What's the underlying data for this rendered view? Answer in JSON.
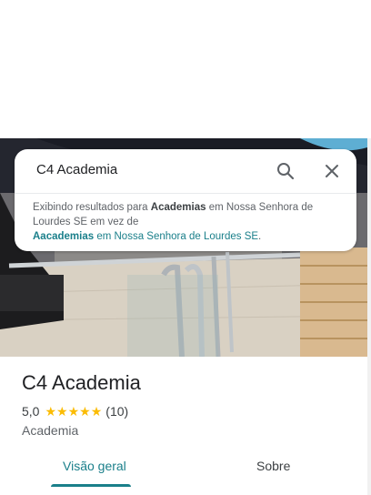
{
  "search": {
    "query": "C4 Academia",
    "search_icon": "search-icon",
    "close_icon": "close-icon"
  },
  "suggestion": {
    "prefix": "Exibindo resultados para ",
    "corrected_term": "Academias",
    "corrected_suffix": " em Nossa Senhora de Lourdes SE em vez de",
    "original_term": "Aacademias",
    "original_suffix": " em Nossa Senhora de Lourdes SE",
    "period": "."
  },
  "place": {
    "title": "C4 Academia",
    "rating": "5,0",
    "stars": 5,
    "review_count": "(10)",
    "category": "Academia"
  },
  "tabs": [
    {
      "label": "Visão geral",
      "active": true
    },
    {
      "label": "Sobre",
      "active": false
    }
  ],
  "colors": {
    "accent": "#1a7f8a",
    "star": "#fbbc04"
  }
}
